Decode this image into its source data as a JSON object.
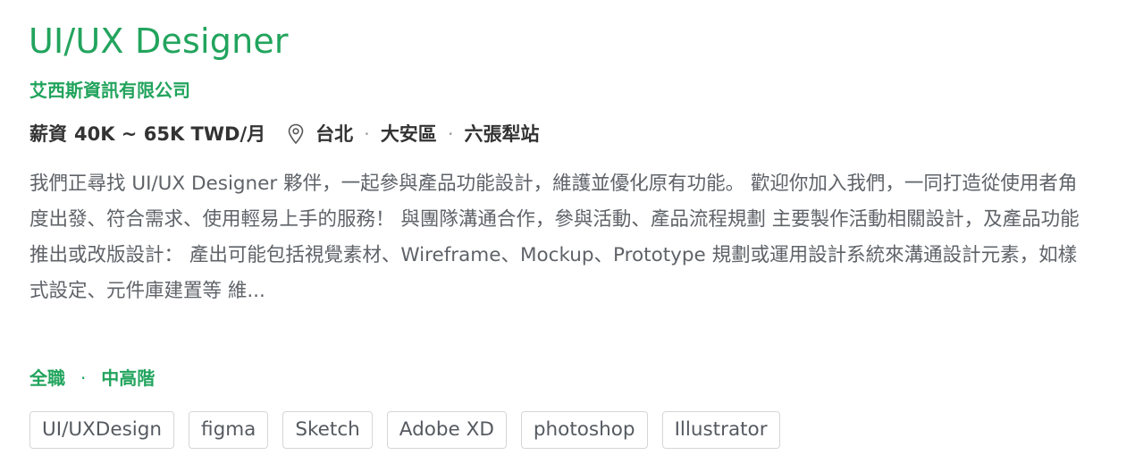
{
  "job": {
    "title": "UI/UX Designer",
    "company": "艾西斯資訊有限公司",
    "salary_label": "薪資",
    "salary_value": "40K ~ 65K TWD/月",
    "location": {
      "icon": "location-pin-icon",
      "city": "台北",
      "district": "大安區",
      "station": "六張犁站"
    },
    "description": "我們正尋找 UI/UX Designer 夥伴，一起參與產品功能設計，維護並優化原有功能。 歡迎你加入我們，一同打造從使用者角度出發、符合需求、使用輕易上手的服務！ 與團隊溝通合作，參與活動、產品流程規劃 主要製作活動相關設計，及產品功能推出或改版設計： 產出可能包括視覺素材、Wireframe、Mockup、Prototype 規劃或運用設計系統來溝通設計元素，如樣式設定、元件庫建置等 維...",
    "employment_type": "全職",
    "seniority": "中高階",
    "separator": "·",
    "skills": [
      "UI/UXDesign",
      "figma",
      "Sketch",
      "Adobe XD",
      "photoshop",
      "Illustrator"
    ]
  },
  "colors": {
    "accent": "#22a45d",
    "text_primary": "#333333",
    "text_secondary": "#5f6368",
    "tag_border": "#d6d6d6"
  }
}
